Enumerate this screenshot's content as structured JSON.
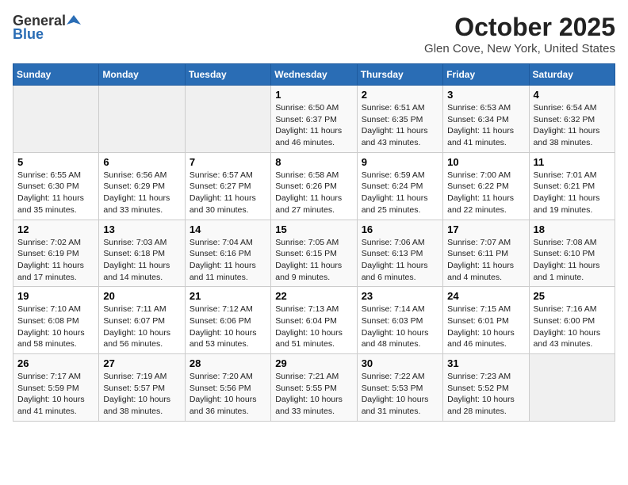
{
  "header": {
    "logo_general": "General",
    "logo_blue": "Blue",
    "title": "October 2025",
    "subtitle": "Glen Cove, New York, United States"
  },
  "days_of_week": [
    "Sunday",
    "Monday",
    "Tuesday",
    "Wednesday",
    "Thursday",
    "Friday",
    "Saturday"
  ],
  "weeks": [
    [
      {
        "day": "",
        "info": ""
      },
      {
        "day": "",
        "info": ""
      },
      {
        "day": "",
        "info": ""
      },
      {
        "day": "1",
        "info": "Sunrise: 6:50 AM\nSunset: 6:37 PM\nDaylight: 11 hours\nand 46 minutes."
      },
      {
        "day": "2",
        "info": "Sunrise: 6:51 AM\nSunset: 6:35 PM\nDaylight: 11 hours\nand 43 minutes."
      },
      {
        "day": "3",
        "info": "Sunrise: 6:53 AM\nSunset: 6:34 PM\nDaylight: 11 hours\nand 41 minutes."
      },
      {
        "day": "4",
        "info": "Sunrise: 6:54 AM\nSunset: 6:32 PM\nDaylight: 11 hours\nand 38 minutes."
      }
    ],
    [
      {
        "day": "5",
        "info": "Sunrise: 6:55 AM\nSunset: 6:30 PM\nDaylight: 11 hours\nand 35 minutes."
      },
      {
        "day": "6",
        "info": "Sunrise: 6:56 AM\nSunset: 6:29 PM\nDaylight: 11 hours\nand 33 minutes."
      },
      {
        "day": "7",
        "info": "Sunrise: 6:57 AM\nSunset: 6:27 PM\nDaylight: 11 hours\nand 30 minutes."
      },
      {
        "day": "8",
        "info": "Sunrise: 6:58 AM\nSunset: 6:26 PM\nDaylight: 11 hours\nand 27 minutes."
      },
      {
        "day": "9",
        "info": "Sunrise: 6:59 AM\nSunset: 6:24 PM\nDaylight: 11 hours\nand 25 minutes."
      },
      {
        "day": "10",
        "info": "Sunrise: 7:00 AM\nSunset: 6:22 PM\nDaylight: 11 hours\nand 22 minutes."
      },
      {
        "day": "11",
        "info": "Sunrise: 7:01 AM\nSunset: 6:21 PM\nDaylight: 11 hours\nand 19 minutes."
      }
    ],
    [
      {
        "day": "12",
        "info": "Sunrise: 7:02 AM\nSunset: 6:19 PM\nDaylight: 11 hours\nand 17 minutes."
      },
      {
        "day": "13",
        "info": "Sunrise: 7:03 AM\nSunset: 6:18 PM\nDaylight: 11 hours\nand 14 minutes."
      },
      {
        "day": "14",
        "info": "Sunrise: 7:04 AM\nSunset: 6:16 PM\nDaylight: 11 hours\nand 11 minutes."
      },
      {
        "day": "15",
        "info": "Sunrise: 7:05 AM\nSunset: 6:15 PM\nDaylight: 11 hours\nand 9 minutes."
      },
      {
        "day": "16",
        "info": "Sunrise: 7:06 AM\nSunset: 6:13 PM\nDaylight: 11 hours\nand 6 minutes."
      },
      {
        "day": "17",
        "info": "Sunrise: 7:07 AM\nSunset: 6:11 PM\nDaylight: 11 hours\nand 4 minutes."
      },
      {
        "day": "18",
        "info": "Sunrise: 7:08 AM\nSunset: 6:10 PM\nDaylight: 11 hours\nand 1 minute."
      }
    ],
    [
      {
        "day": "19",
        "info": "Sunrise: 7:10 AM\nSunset: 6:08 PM\nDaylight: 10 hours\nand 58 minutes."
      },
      {
        "day": "20",
        "info": "Sunrise: 7:11 AM\nSunset: 6:07 PM\nDaylight: 10 hours\nand 56 minutes."
      },
      {
        "day": "21",
        "info": "Sunrise: 7:12 AM\nSunset: 6:06 PM\nDaylight: 10 hours\nand 53 minutes."
      },
      {
        "day": "22",
        "info": "Sunrise: 7:13 AM\nSunset: 6:04 PM\nDaylight: 10 hours\nand 51 minutes."
      },
      {
        "day": "23",
        "info": "Sunrise: 7:14 AM\nSunset: 6:03 PM\nDaylight: 10 hours\nand 48 minutes."
      },
      {
        "day": "24",
        "info": "Sunrise: 7:15 AM\nSunset: 6:01 PM\nDaylight: 10 hours\nand 46 minutes."
      },
      {
        "day": "25",
        "info": "Sunrise: 7:16 AM\nSunset: 6:00 PM\nDaylight: 10 hours\nand 43 minutes."
      }
    ],
    [
      {
        "day": "26",
        "info": "Sunrise: 7:17 AM\nSunset: 5:59 PM\nDaylight: 10 hours\nand 41 minutes."
      },
      {
        "day": "27",
        "info": "Sunrise: 7:19 AM\nSunset: 5:57 PM\nDaylight: 10 hours\nand 38 minutes."
      },
      {
        "day": "28",
        "info": "Sunrise: 7:20 AM\nSunset: 5:56 PM\nDaylight: 10 hours\nand 36 minutes."
      },
      {
        "day": "29",
        "info": "Sunrise: 7:21 AM\nSunset: 5:55 PM\nDaylight: 10 hours\nand 33 minutes."
      },
      {
        "day": "30",
        "info": "Sunrise: 7:22 AM\nSunset: 5:53 PM\nDaylight: 10 hours\nand 31 minutes."
      },
      {
        "day": "31",
        "info": "Sunrise: 7:23 AM\nSunset: 5:52 PM\nDaylight: 10 hours\nand 28 minutes."
      },
      {
        "day": "",
        "info": ""
      }
    ]
  ]
}
